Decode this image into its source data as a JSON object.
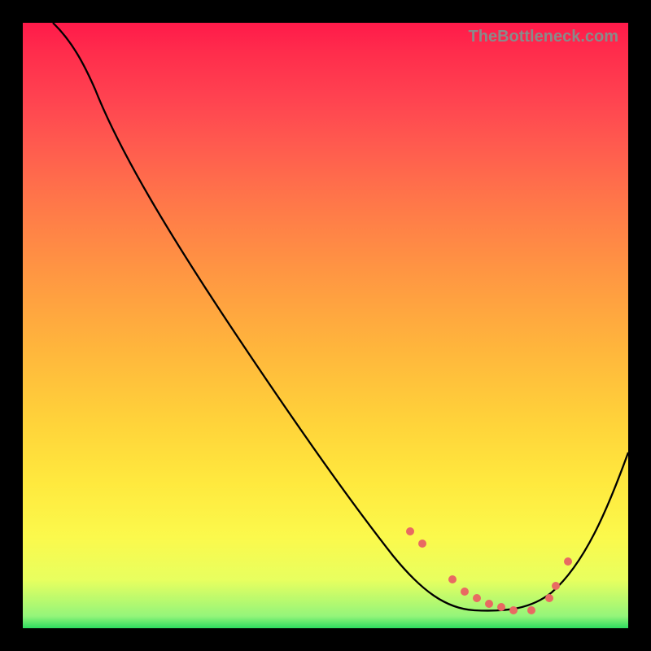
{
  "attribution": "TheBottleneck.com",
  "colors": {
    "frame": "#000000",
    "curve": "#000000",
    "markers": "#e86a62"
  },
  "chart_data": {
    "type": "line",
    "title": "",
    "xlabel": "",
    "ylabel": "",
    "xlim": [
      0,
      100
    ],
    "ylim": [
      0,
      100
    ],
    "grid": false,
    "series": [
      {
        "name": "curve",
        "x": [
          5,
          8,
          12,
          18,
          25,
          33,
          42,
          51,
          60,
          66,
          70,
          73,
          76,
          80,
          83,
          86,
          89,
          92,
          95,
          99
        ],
        "y": [
          100,
          97,
          92,
          84,
          74,
          62,
          48,
          35,
          22,
          14,
          9,
          6,
          4,
          3,
          3,
          4,
          8,
          13,
          20,
          29
        ]
      }
    ],
    "markers": {
      "name": "highlight-points",
      "color": "#e86a62",
      "x": [
        64,
        66,
        71,
        73,
        75,
        77,
        79,
        81,
        84,
        87,
        88,
        90
      ],
      "y": [
        16,
        14,
        8,
        6,
        5,
        4,
        3.5,
        3,
        3,
        5,
        7,
        11
      ]
    }
  }
}
